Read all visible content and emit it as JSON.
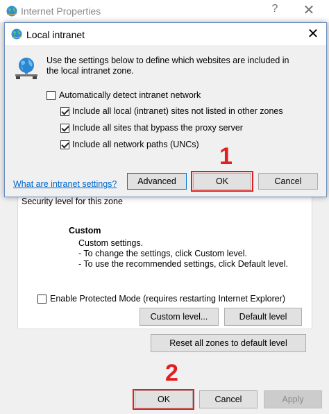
{
  "background_window": {
    "title": "Internet Properties",
    "help_glyph": "?",
    "close_glyph": "✕",
    "security_level_label": "Security level for this zone",
    "custom_heading": "Custom",
    "custom_lines": [
      "Custom settings.",
      "- To change the settings, click Custom level.",
      "- To use the recommended settings, click Default level."
    ],
    "protected_mode": {
      "label": "Enable Protected Mode (requires restarting Internet Explorer)",
      "checked": false
    },
    "custom_level_label": "Custom level...",
    "default_level_label": "Default level",
    "reset_all_label": "Reset all zones to default level",
    "ok_label": "OK",
    "cancel_label": "Cancel",
    "apply_label": "Apply"
  },
  "dialog": {
    "title": "Local intranet",
    "close_glyph": "✕",
    "description_lines": [
      "Use the settings below to define which websites are included in",
      "the local intranet zone."
    ],
    "auto_detect": {
      "label": "Automatically detect intranet network",
      "checked": false
    },
    "options": [
      {
        "label": "Include all local (intranet) sites not listed in other zones",
        "checked": true
      },
      {
        "label": "Include all sites that bypass the proxy server",
        "checked": true
      },
      {
        "label": "Include all network paths (UNCs)",
        "checked": true
      }
    ],
    "link_label": "What are intranet settings?",
    "advanced_label": "Advanced",
    "ok_label": "OK",
    "cancel_label": "Cancel"
  },
  "annotations": {
    "step1": "1",
    "step2": "2",
    "highlight_color": "#e02020"
  },
  "icons": {
    "title_icon": "globe-icon",
    "dialog_icon": "globe-network-icon"
  }
}
